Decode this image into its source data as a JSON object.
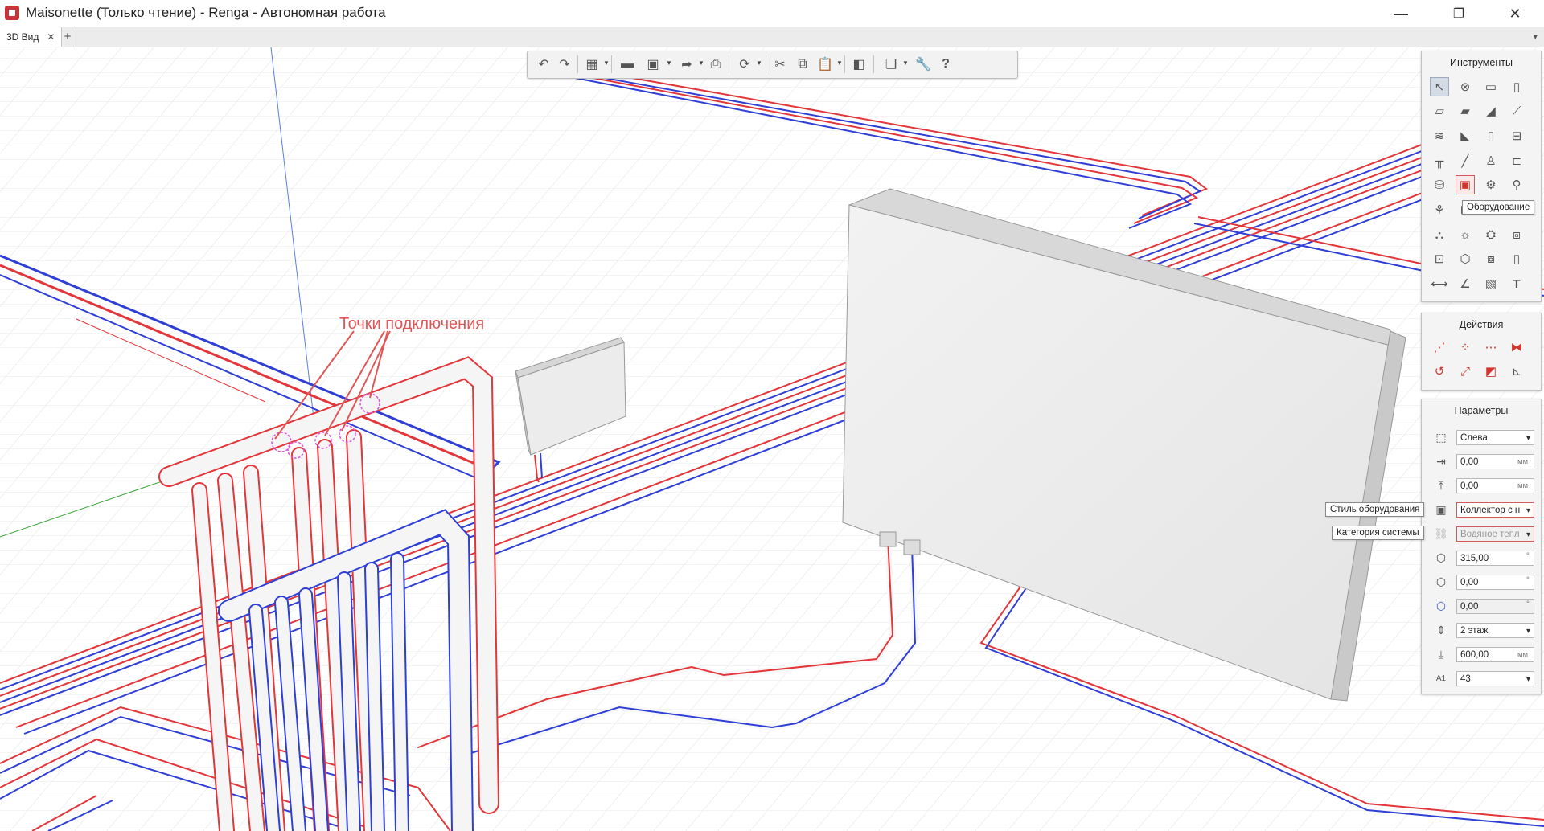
{
  "window": {
    "title": "Maisonette (Только чтение) - Renga - Автономная работа",
    "minimize": "—",
    "restore": "❐",
    "close": "✕"
  },
  "tabs": [
    {
      "label": "3D Вид",
      "close": "✕"
    }
  ],
  "tab_add": "+",
  "tab_menu": "▾",
  "toolbar": {
    "icons": [
      "undo-icon",
      "redo-icon",
      "3d-view-icon",
      "open-folder-icon",
      "save-icon",
      "export-icon",
      "print-icon",
      "orbit-icon",
      "cut-icon",
      "copy-icon",
      "paste-icon",
      "layout-icon",
      "views-icon",
      "settings-wrench-icon",
      "help-icon"
    ]
  },
  "tools_panel": {
    "title": "Инструменты",
    "tooltip": "Оборудование"
  },
  "actions_panel": {
    "title": "Действия"
  },
  "params_panel": {
    "title": "Параметры",
    "rows": [
      {
        "value": "Слева",
        "unit": ""
      },
      {
        "value": "0,00",
        "unit": "мм"
      },
      {
        "value": "0,00",
        "unit": "мм"
      },
      {
        "value": "Коллектор с н",
        "unit": ""
      },
      {
        "value": "Водяное тепл",
        "unit": ""
      },
      {
        "value": "315,00",
        "unit": "°"
      },
      {
        "value": "0,00",
        "unit": "°"
      },
      {
        "value": "0,00",
        "unit": "°"
      },
      {
        "value": "2 этаж",
        "unit": ""
      },
      {
        "value": "600,00",
        "unit": "мм"
      },
      {
        "value": "43",
        "unit": ""
      }
    ],
    "tooltip_style": "Стиль оборудования",
    "tooltip_category": "Категория системы"
  },
  "annotation": "Точки подключения",
  "colors": {
    "supply_pipe": "#e2363a",
    "return_pipe": "#2f3fd6",
    "grid": "#e3e3e3",
    "highlight": "#d35a5a"
  }
}
